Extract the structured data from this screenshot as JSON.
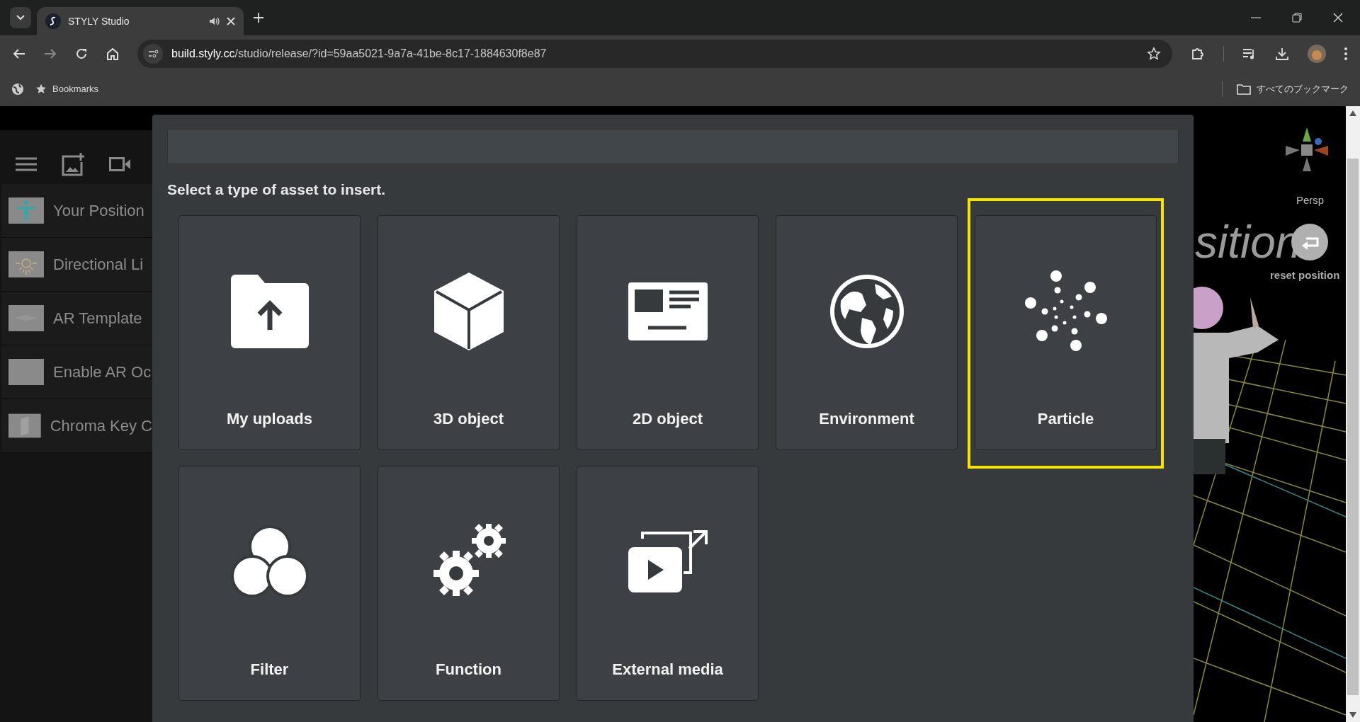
{
  "browser": {
    "tab": {
      "title": "STYLY Studio",
      "selected": true
    },
    "url": {
      "host": "build.styly.cc",
      "path": "/studio/release/?id=59aa5021-9a7a-41be-8c17-1884630f8e87"
    },
    "bookmarks": [
      {
        "label": "Bookmarks"
      }
    ],
    "all_bookmarks": "すべてのブックマーク"
  },
  "sidebar": {
    "items": [
      {
        "label": "Your Position",
        "kind": "person"
      },
      {
        "label": "Directional Li",
        "kind": "light"
      },
      {
        "label": "AR Template",
        "kind": "plane"
      },
      {
        "label": "Enable AR Oc",
        "kind": "blank"
      },
      {
        "label": "Chroma Key C",
        "kind": "panel"
      }
    ]
  },
  "viewport": {
    "big_text": "sition",
    "camera": "Persp",
    "reset": "reset position"
  },
  "dialog": {
    "heading": "Select a type of asset to insert.",
    "assets": [
      {
        "label": "My uploads",
        "kind": "upload",
        "selected": false
      },
      {
        "label": "3D object",
        "kind": "cube",
        "selected": false
      },
      {
        "label": "2D object",
        "kind": "card",
        "selected": false
      },
      {
        "label": "Environment",
        "kind": "globe",
        "selected": false
      },
      {
        "label": "Particle",
        "kind": "particle",
        "selected": true
      },
      {
        "label": "Filter",
        "kind": "filter",
        "selected": false
      },
      {
        "label": "Function",
        "kind": "gears",
        "selected": false
      },
      {
        "label": "External media",
        "kind": "media",
        "selected": false
      }
    ]
  }
}
